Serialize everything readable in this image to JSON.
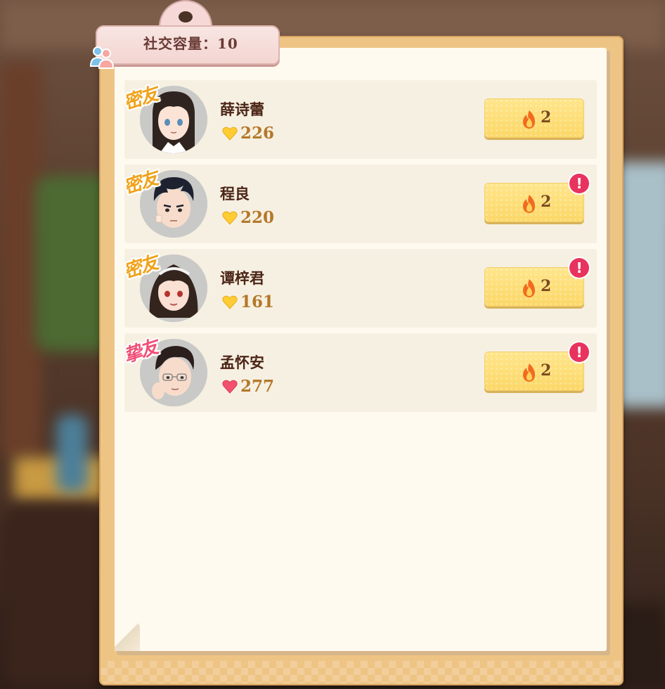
{
  "capacity": {
    "text": "社交容量：10"
  },
  "friends": [
    {
      "name": "薛诗蕾",
      "affection": "226",
      "heart_color": "#ffcc33",
      "relation": "密友",
      "stamp_color": "gold",
      "fire": "2",
      "alert": false,
      "alert_symbol": "!",
      "hair": "#2f2420",
      "icon": "girl-long-hair-avatar"
    },
    {
      "name": "程良",
      "affection": "220",
      "heart_color": "#ffcc33",
      "relation": "密友",
      "stamp_color": "gold",
      "fire": "2",
      "alert": true,
      "alert_symbol": "!",
      "hair": "#1d2130",
      "icon": "boy-short-hair-avatar"
    },
    {
      "name": "谭梓君",
      "affection": "161",
      "heart_color": "#ffcc33",
      "relation": "密友",
      "stamp_color": "gold",
      "fire": "2",
      "alert": true,
      "alert_symbol": "!",
      "hair": "#34241e",
      "icon": "girl-headband-avatar"
    },
    {
      "name": "孟怀安",
      "affection": "277",
      "heart_color": "#f2506e",
      "relation": "挚友",
      "stamp_color": "pink",
      "fire": "2",
      "alert": true,
      "alert_symbol": "!",
      "hair": "#2a1f1c",
      "icon": "boy-glasses-avatar"
    }
  ],
  "colors": {
    "board": "#eec485",
    "paper": "#fffaf0",
    "button": "#fbd767",
    "alert": "#e8335e"
  }
}
